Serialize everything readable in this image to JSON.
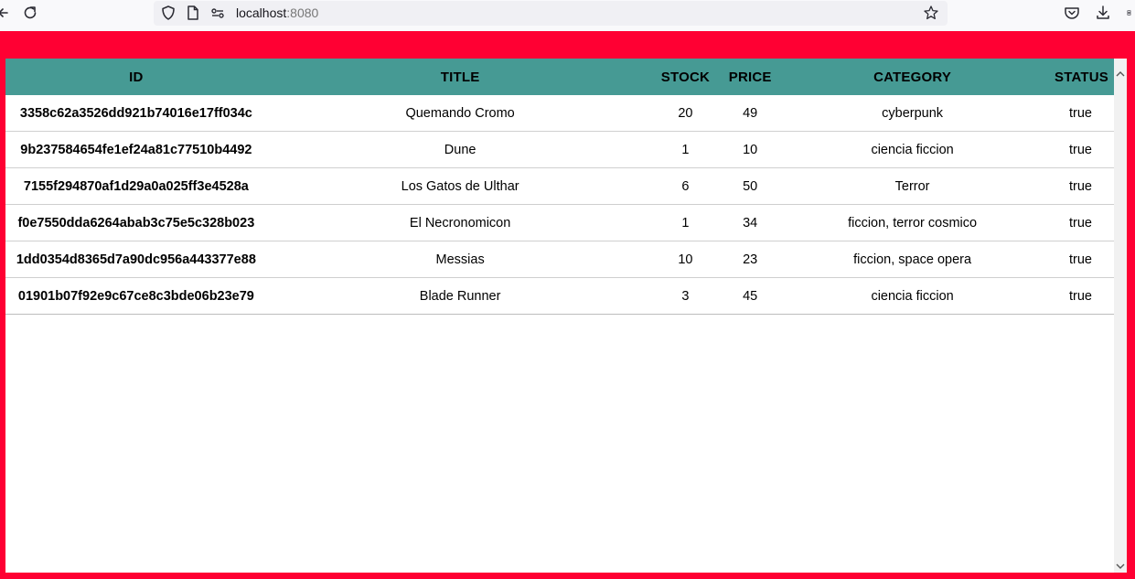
{
  "browser": {
    "url_host": "localhost",
    "url_port": ":8080"
  },
  "table": {
    "headers": {
      "id": "ID",
      "title": "TITLE",
      "stock": "STOCK",
      "price": "PRICE",
      "category": "CATEGORY",
      "status": "STATUS"
    },
    "rows": [
      {
        "id": "3358c62a3526dd921b74016e17ff034c",
        "title": "Quemando Cromo",
        "stock": "20",
        "price": "49",
        "category": "cyberpunk",
        "status": "true"
      },
      {
        "id": "9b237584654fe1ef24a81c77510b4492",
        "title": "Dune",
        "stock": "1",
        "price": "10",
        "category": "ciencia ficcion",
        "status": "true"
      },
      {
        "id": "7155f294870af1d29a0a025ff3e4528a",
        "title": "Los Gatos de Ulthar",
        "stock": "6",
        "price": "50",
        "category": "Terror",
        "status": "true"
      },
      {
        "id": "f0e7550dda6264abab3c75e5c328b023",
        "title": "El Necronomicon",
        "stock": "1",
        "price": "34",
        "category": "ficcion, terror cosmico",
        "status": "true"
      },
      {
        "id": "1dd0354d8365d7a90dc956a443377e88",
        "title": "Messias",
        "stock": "10",
        "price": "23",
        "category": "ficcion, space opera",
        "status": "true"
      },
      {
        "id": "01901b07f92e9c67ce8c3bde06b23e79",
        "title": "Blade Runner",
        "stock": "3",
        "price": "45",
        "category": "ciencia ficcion",
        "status": "true"
      }
    ]
  },
  "colors": {
    "page_background": "#ff0033",
    "table_header": "#469a94"
  },
  "icons": [
    "back-icon",
    "reload-icon",
    "shield-icon",
    "page-icon",
    "permissions-icon",
    "bookmark-star-icon",
    "pocket-icon",
    "download-icon",
    "extensions-icon"
  ]
}
